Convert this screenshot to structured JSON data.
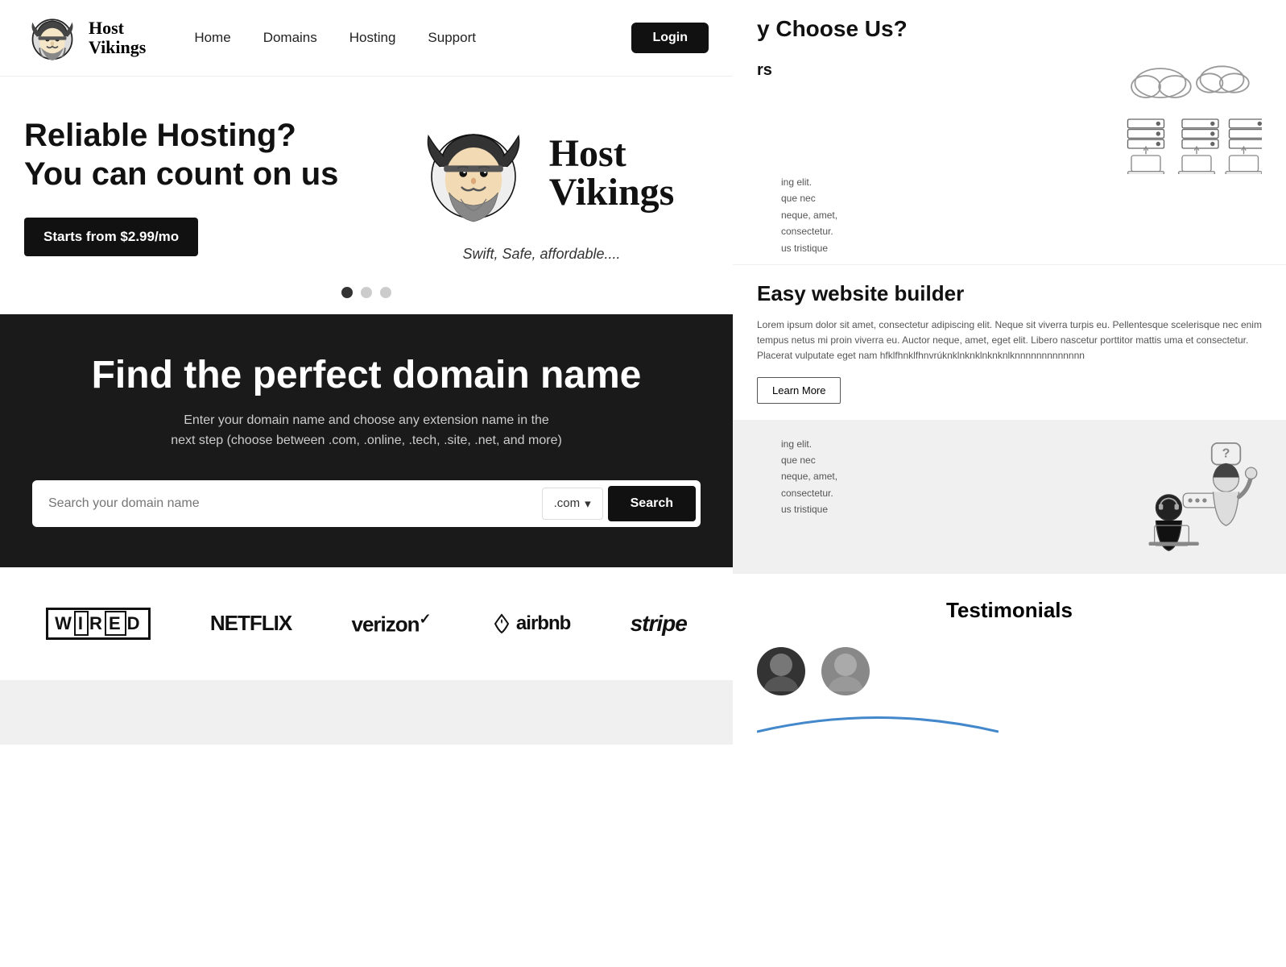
{
  "nav": {
    "logo_line1": "Host",
    "logo_line2": "Vikings",
    "links": [
      "Home",
      "Domains",
      "Hosting",
      "Support"
    ],
    "login_label": "Login"
  },
  "hero": {
    "title_line1": "Reliable Hosting?",
    "title_line2": "You can count on us",
    "cta_label": "Starts from $2.99/mo",
    "brand_name_line1": "Host",
    "brand_name_line2": "Vikings",
    "tagline": "Swift, Safe, affordable...."
  },
  "domain": {
    "title": "Find the perfect domain name",
    "subtitle_line1": "Enter your  domain name and choose any extension name in the",
    "subtitle_line2": "next step (choose between .com, .online, .tech, .site, .net, and more)",
    "input_placeholder": "Search your domain name",
    "ext_label": ".com",
    "search_btn": "Search"
  },
  "brands": [
    "WIRED",
    "NETFLIX",
    "verizon✓",
    "⌂ airbnb",
    "stripe"
  ],
  "right": {
    "why_choose_title": "y Choose Us?",
    "rs_label": "rs",
    "easy_builder_title": "Easy website builder",
    "easy_builder_text": "Lorem ipsum dolor sit amet, consectetur adipiscing elit. Neque sit viverra turpis eu. Pellentesque scelerisque nec enim tempus netus mi proin viverra eu. Auctor neque, amet, eget elit. Libero nascetur porttitor mattis uma et consectetur. Placerat vulputate eget nam hfklfhnklfhnvrúknklnknklnknknlknnnnnnnnnnnnn",
    "learn_more_label": "Learn More",
    "partial_text": "ing elit.\nque nec\nneque, amet,\nconsectetur.\nus tristique",
    "partial_text2": "ing elit.\nque nec\nneque, amet,\nconsectetur.\nus tristique",
    "testimonials_title": "Testimonials"
  }
}
